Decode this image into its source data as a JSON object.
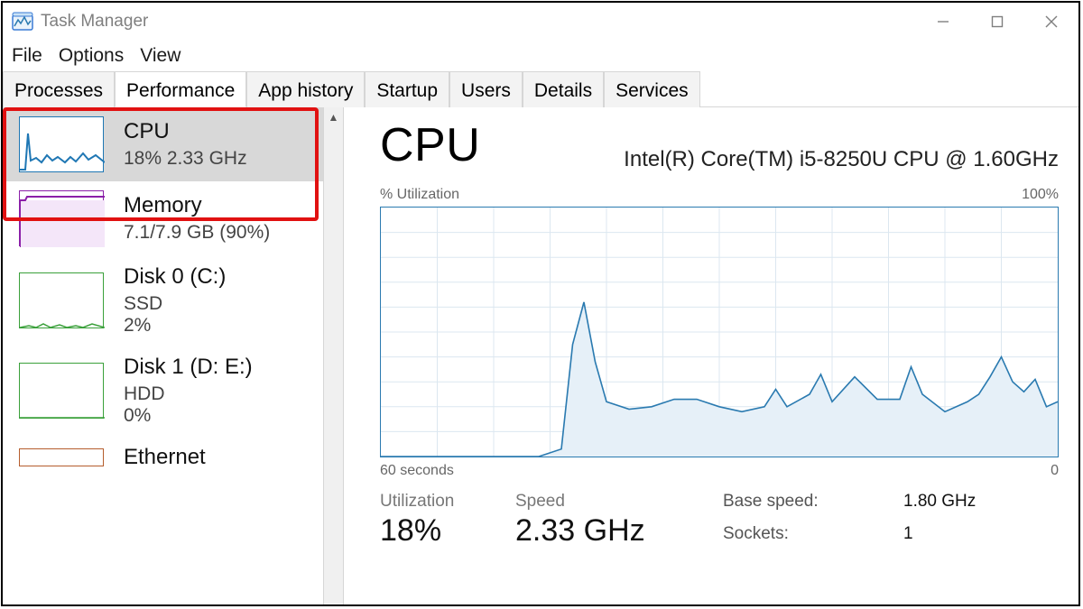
{
  "window": {
    "title": "Task Manager"
  },
  "menu": {
    "file": "File",
    "options": "Options",
    "view": "View"
  },
  "tabs": [
    {
      "label": "Processes"
    },
    {
      "label": "Performance",
      "active": true
    },
    {
      "label": "App history"
    },
    {
      "label": "Startup"
    },
    {
      "label": "Users"
    },
    {
      "label": "Details"
    },
    {
      "label": "Services"
    }
  ],
  "sidebar": {
    "items": [
      {
        "name": "CPU",
        "sub": "18%  2.33 GHz",
        "color": "#1f77b4",
        "selected": true
      },
      {
        "name": "Memory",
        "sub": "7.1/7.9 GB (90%)",
        "color": "#8b1fa8"
      },
      {
        "name": "Disk 0 (C:)",
        "sub": "SSD\n2%",
        "color": "#3aa03a"
      },
      {
        "name": "Disk 1 (D: E:)",
        "sub": "HDD\n0%",
        "color": "#3aa03a"
      },
      {
        "name": "Ethernet",
        "sub": "",
        "color": "#b55d2d"
      }
    ]
  },
  "main": {
    "title": "CPU",
    "model": "Intel(R) Core(TM) i5-8250U CPU @ 1.60GHz",
    "axis_top_left": "% Utilization",
    "axis_top_right": "100%",
    "axis_bot_left": "60 seconds",
    "axis_bot_right": "0",
    "stats": {
      "utilization_label": "Utilization",
      "utilization_value": "18%",
      "speed_label": "Speed",
      "speed_value": "2.33 GHz",
      "base_speed_label": "Base speed:",
      "base_speed_value": "1.80 GHz",
      "sockets_label": "Sockets:",
      "sockets_value": "1"
    }
  },
  "chart_data": {
    "type": "line",
    "title": "CPU % Utilization",
    "xlabel": "seconds ago",
    "ylabel": "% Utilization",
    "xlim": [
      60,
      0
    ],
    "ylim": [
      0,
      100
    ],
    "x": [
      60,
      58,
      56,
      54,
      52,
      50,
      48,
      46,
      44,
      43,
      42,
      41,
      40,
      38,
      36,
      34,
      32,
      30,
      28,
      26,
      25,
      24,
      22,
      21,
      20,
      18,
      16,
      14,
      13,
      12,
      10,
      8,
      7,
      6,
      5,
      4,
      3,
      2,
      1,
      0
    ],
    "values": [
      0,
      0,
      0,
      0,
      0,
      0,
      0,
      0,
      3,
      45,
      62,
      38,
      22,
      19,
      20,
      23,
      23,
      20,
      18,
      20,
      27,
      20,
      25,
      33,
      22,
      32,
      23,
      23,
      36,
      25,
      18,
      22,
      25,
      32,
      40,
      30,
      26,
      31,
      20,
      22
    ]
  }
}
